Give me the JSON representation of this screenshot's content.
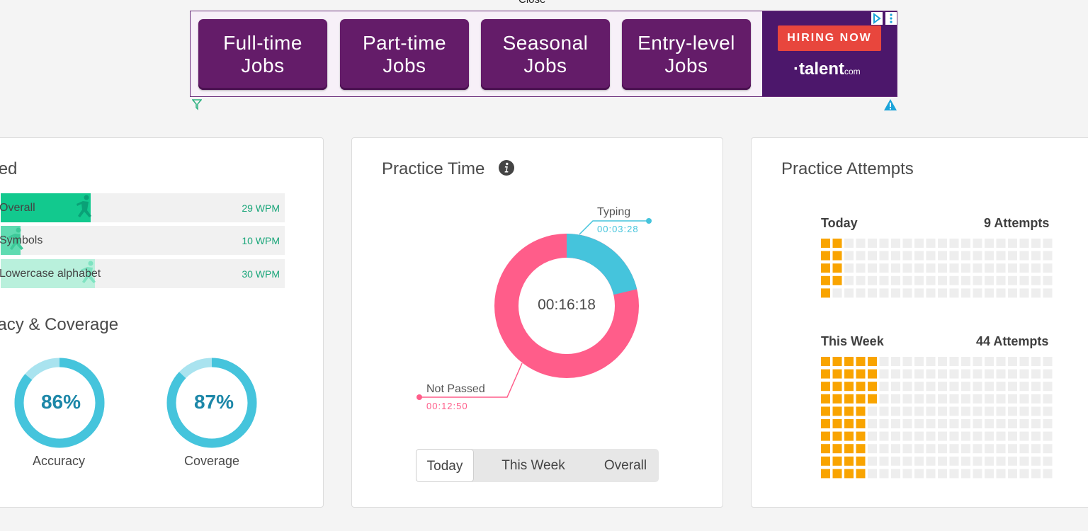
{
  "ad": {
    "close_label": "Close",
    "buttons": [
      {
        "line1": "Full-time",
        "line2": "Jobs"
      },
      {
        "line1": "Part-time",
        "line2": "Jobs"
      },
      {
        "line1": "Seasonal",
        "line2": "Jobs"
      },
      {
        "line1": "Entry-level",
        "line2": "Jobs"
      }
    ],
    "hiring_label": "HIRING NOW",
    "brand": "·talent",
    "brand_suffix": "com",
    "icons": [
      "adchoices-icon",
      "more-vertical-icon",
      "filter-icon",
      "warning-icon"
    ]
  },
  "speed": {
    "title": "Speed",
    "rows": [
      {
        "label": "Overall",
        "value": "29 WPM",
        "fill_color": "#12c98e"
      },
      {
        "label": "Symbols",
        "value": "10 WPM",
        "fill_color": "#5fdbb1"
      },
      {
        "label": "Lowercase alphabet",
        "value": "30 WPM",
        "fill_color": "#b9f0dc"
      }
    ]
  },
  "accuracy": {
    "title": "Accuracy & Coverage",
    "accuracy_value": "86%",
    "accuracy_label": "Accuracy",
    "accuracy_fraction": 0.86,
    "coverage_value": "87%",
    "coverage_label": "Coverage",
    "coverage_fraction": 0.87,
    "ring_color": "#45c4dc",
    "ring_track_color": "#a9e3ef"
  },
  "practice_time": {
    "title": "Practice Time",
    "total": "00:16:18",
    "segments": [
      {
        "name": "Typing",
        "time": "00:03:28",
        "color": "#45c4dc",
        "seconds": 208
      },
      {
        "name": "Not Passed",
        "time": "00:12:50",
        "color": "#ff5d8a",
        "seconds": 770
      }
    ],
    "tabs": [
      "Today",
      "This Week",
      "Overall"
    ],
    "active_tab": "Today"
  },
  "attempts": {
    "title": "Practice Attempts",
    "today_label": "Today",
    "today_value": "9 Attempts",
    "today_count": 9,
    "week_label": "This Week",
    "week_value": "44 Attempts",
    "week_count": 44,
    "filled_color": "#f9a400",
    "empty_color": "#eeeeee"
  }
}
